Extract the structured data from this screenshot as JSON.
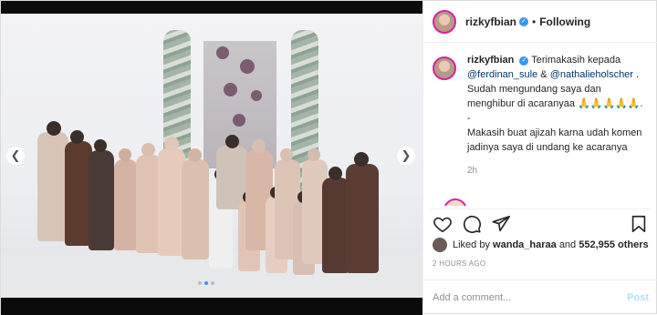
{
  "post": {
    "username": "rizkyfbian",
    "separator": "•",
    "follow_label": "Following",
    "caption": {
      "username": "rizkyfbian",
      "text_prefix": "Terimakasih kepada",
      "mention1": "@ferdinan_sule",
      "amp": "&",
      "mention2": "@nathalieholscher",
      "text_after_mentions": ". Sudah mengundang saya dan menghibur di acaranyaa 🙏🙏🙏🙏🙏.",
      "dash": "-",
      "text2": "Makasih buat ajizah karna udah komen jadinya saya di undang ke acaranya",
      "time": "2h"
    },
    "likes": {
      "prefix": "Liked by",
      "user": "wanda_haraa",
      "and": "and",
      "count": "552,955 others"
    },
    "timestamp": "2 HOURS AGO",
    "comment_box": {
      "placeholder": "Add a comment...",
      "post_label": "Post"
    },
    "carousel": {
      "slides": 3,
      "active": 2
    },
    "colors": {
      "verified": "#3897f0",
      "link": "#00376b",
      "post_disabled": "#b2dffc"
    },
    "icons": [
      "heart-icon",
      "comment-icon",
      "share-icon",
      "bookmark-icon",
      "chevron-left-icon",
      "chevron-right-icon"
    ]
  }
}
